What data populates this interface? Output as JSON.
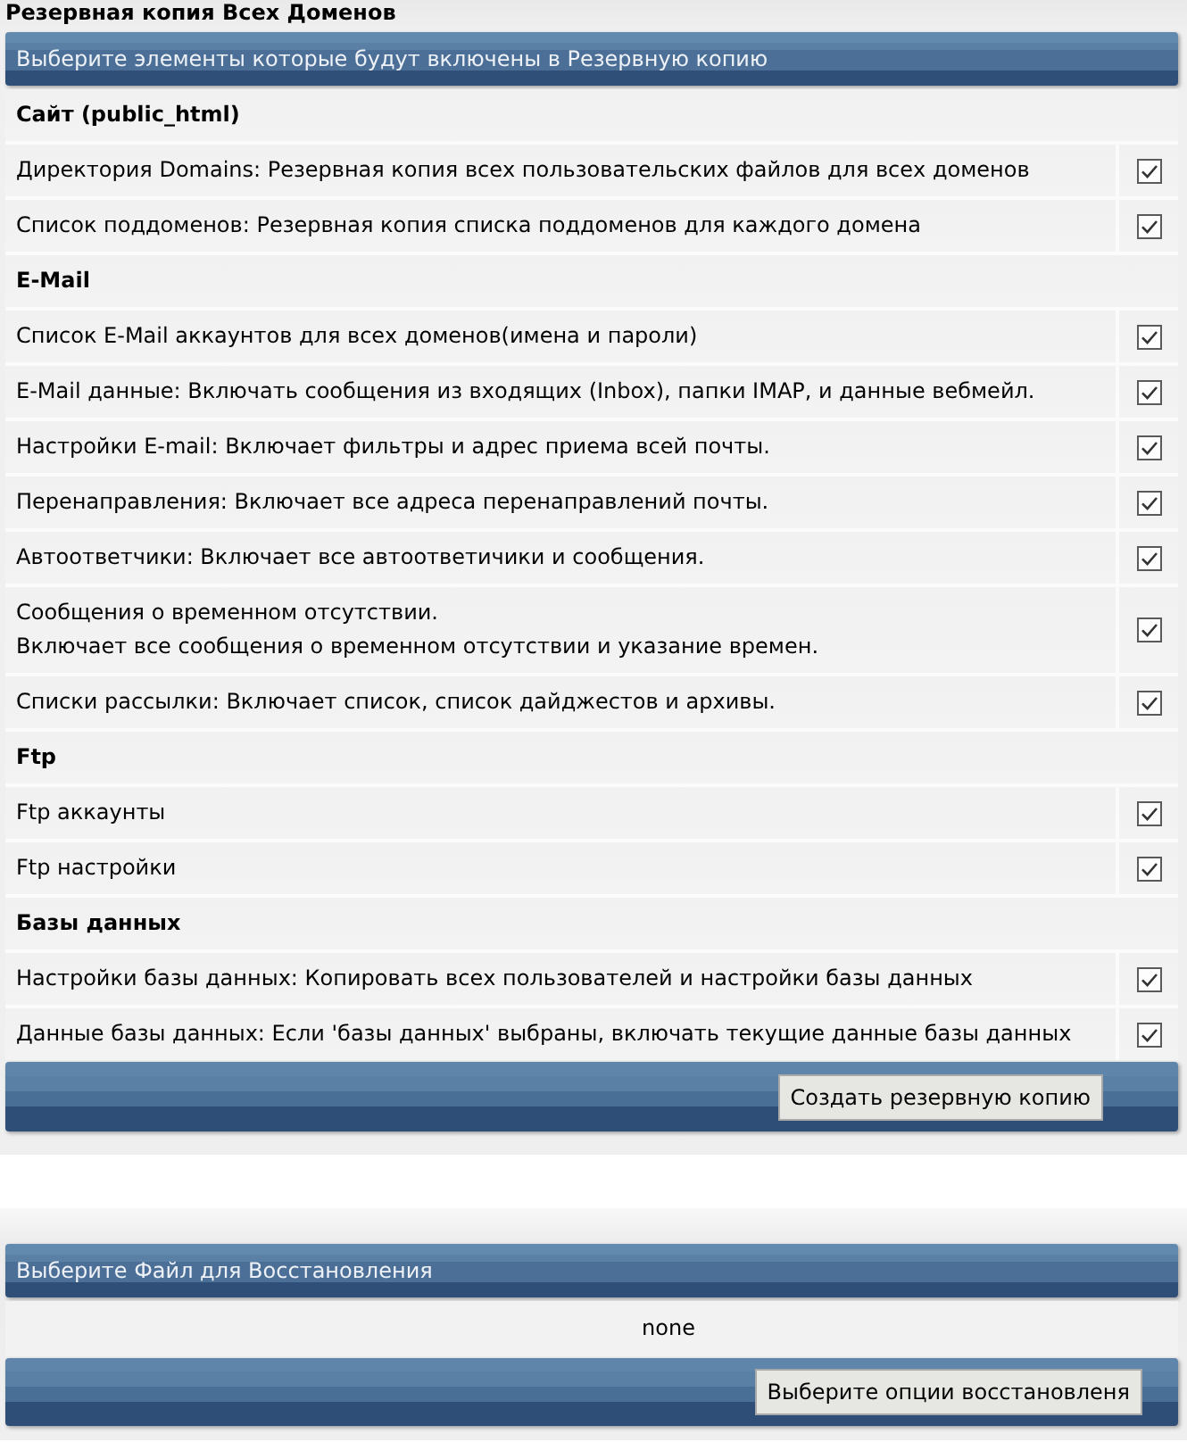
{
  "title": "Резервная копия Всех Доменов",
  "backup": {
    "header": "Выберите элементы которые будут включены в Резервную копию",
    "sections": [
      {
        "title": "Сайт (public_html)",
        "items": [
          {
            "label": "Директория Domains: Резервная копия всех пользовательских файлов для всех доменов",
            "checked": true
          },
          {
            "label": "Список поддоменов: Резервная копия списка поддоменов для каждого домена",
            "checked": true
          }
        ]
      },
      {
        "title": "E-Mail",
        "items": [
          {
            "label": "Список E-Mail аккаунтов для всех доменов(имена и пароли)",
            "checked": true
          },
          {
            "label": "E-Mail данные: Включать сообщения из входящих (Inbox), папки IMAP, и данные вебмейл.",
            "checked": true
          },
          {
            "label": "Настройки E-mail: Включает фильтры и адрес приема всей почты.",
            "checked": true
          },
          {
            "label": "Перенаправления: Включает все адреса перенаправлений почты.",
            "checked": true
          },
          {
            "label": "Автоответчики: Включает все автоответичики и сообщения.",
            "checked": true
          },
          {
            "label": "Сообщения о временном отсутствии.\nВключает все сообщения о временном отсутствии и указание времен.",
            "checked": true
          },
          {
            "label": "Списки рассылки: Включает список, список дайджестов и архивы.",
            "checked": true
          }
        ]
      },
      {
        "title": "Ftp",
        "items": [
          {
            "label": "Ftp аккаунты",
            "checked": true
          },
          {
            "label": "Ftp настройки",
            "checked": true
          }
        ]
      },
      {
        "title": "Базы данных",
        "items": [
          {
            "label": "Настройки базы данных: Копировать всех пользователей и настройки базы данных",
            "checked": true
          },
          {
            "label": "Данные базы данных: Если 'базы данных' выбраны, включать текущие данные базы данных",
            "checked": true
          }
        ]
      }
    ],
    "button": "Создать резервную копию"
  },
  "restore": {
    "header": "Выберите Файл для Восстановления",
    "file": "none",
    "button": "Выберите опции восстановленя"
  }
}
